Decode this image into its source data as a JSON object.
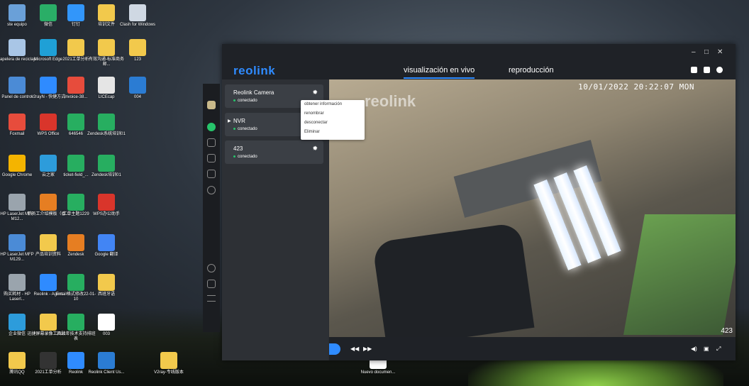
{
  "desktop": {
    "icons": [
      {
        "label": "ste equipo",
        "icon": "computer-icon",
        "color": "#6aa0d8"
      },
      {
        "label": "微信",
        "icon": "wechat-icon",
        "color": "#2aae67"
      },
      {
        "label": "钉钉",
        "icon": "dingtalk-icon",
        "color": "#3296fa"
      },
      {
        "label": "培训文件",
        "icon": "folder-icon",
        "color": "#f2c94c"
      },
      {
        "label": "Clash for Windows",
        "icon": "clash-icon",
        "color": "#cfd8e3"
      },
      {
        "label": "Papelera de reciclaje",
        "icon": "recycle-bin-icon",
        "color": "#a9c6e6"
      },
      {
        "label": "Microsoft Edge",
        "icon": "edge-icon",
        "color": "#1fa0d6"
      },
      {
        "label": "2021工单分析",
        "icon": "excel-icon",
        "color": "#f2c94c"
      },
      {
        "label": "有效沟通-标准商务邮...",
        "icon": "folder-icon",
        "color": "#f2c94c"
      },
      {
        "label": "123",
        "icon": "folder-icon",
        "color": "#f2c94c"
      },
      {
        "label": "Panel de control",
        "icon": "control-panel-icon",
        "color": "#4b8bd6"
      },
      {
        "label": "v2rayN - 快捷方式",
        "icon": "v2rayn-icon",
        "color": "#2f8bff"
      },
      {
        "label": "Invoice-38...",
        "icon": "pdf-icon",
        "color": "#e74c3c"
      },
      {
        "label": "LICEcap",
        "icon": "licecap-icon",
        "color": "#e5e5e5"
      },
      {
        "label": "004",
        "icon": "word-icon",
        "color": "#2b7cd3"
      },
      {
        "label": "Foxmail",
        "icon": "foxmail-icon",
        "color": "#e74c3c"
      },
      {
        "label": "WPS Office",
        "icon": "wps-icon",
        "color": "#d9352b"
      },
      {
        "label": "646546",
        "icon": "sheet-icon",
        "color": "#27ae60"
      },
      {
        "label": "Zendesk系统培训01",
        "icon": "sheet-icon",
        "color": "#27ae60"
      },
      {
        "label": "Google Chrome",
        "icon": "chrome-icon",
        "color": "#f4b400"
      },
      {
        "label": "云之家",
        "icon": "cloud-icon",
        "color": "#2d9cdb"
      },
      {
        "label": "ticket-field_...",
        "icon": "sheet-icon",
        "color": "#27ae60"
      },
      {
        "label": "Zendesk培训01",
        "icon": "sheet-icon",
        "color": "#27ae60"
      },
      {
        "label": "HP LaserJet MFP M12...",
        "icon": "printer-icon",
        "color": "#9aa4ad"
      },
      {
        "label": "新员工介绍模板（香...",
        "icon": "ppt-icon",
        "color": "#e67e22"
      },
      {
        "label": "工单主题1229",
        "icon": "sheet-icon",
        "color": "#27ae60"
      },
      {
        "label": "WPS办公助手",
        "icon": "wps-icon",
        "color": "#d9352b"
      },
      {
        "label": "HP LaserJet MFP M129...",
        "icon": "scanner-icon",
        "color": "#4b8bd6"
      },
      {
        "label": "产品培训资料",
        "icon": "folder-icon",
        "color": "#f2c94c"
      },
      {
        "label": "Zendesk",
        "icon": "ppt-icon",
        "color": "#e67e22"
      },
      {
        "label": "Google 翻译",
        "icon": "translate-icon",
        "color": "#4285f4"
      },
      {
        "label": "购买耗材 - HP Laserl...",
        "icon": "printer-icon",
        "color": "#9aa4ad"
      },
      {
        "label": "Reolink - Agent",
        "icon": "reolink-icon",
        "color": "#2f8bff"
      },
      {
        "label": "Email格式修改22-01-10",
        "icon": "sheet-icon",
        "color": "#27ae60"
      },
      {
        "label": "西班牙语",
        "icon": "folder-icon",
        "color": "#f2c94c"
      },
      {
        "label": "企业微信",
        "icon": "wework-icon",
        "color": "#2d9cdb"
      },
      {
        "label": "迅捷屏幕录像工具破...",
        "icon": "folder-icon",
        "color": "#f2c94c"
      },
      {
        "label": "2021年技术支持排班表",
        "icon": "sheet-icon",
        "color": "#27ae60"
      },
      {
        "label": "003",
        "icon": "doc-icon",
        "color": "#ffffff"
      },
      {
        "label": "腾讯QQ",
        "icon": "qq-icon",
        "color": "#f2c94c"
      },
      {
        "label": "2021工单分析",
        "icon": "7zip-icon",
        "color": "#333333"
      },
      {
        "label": "Reolink",
        "icon": "reolink-icon",
        "color": "#2f8bff"
      },
      {
        "label": "Reolink Client Us...",
        "icon": "word-icon",
        "color": "#2b7cd3"
      },
      {
        "label": "V2ray-专线版本",
        "icon": "folder-icon",
        "color": "#f2c94c"
      },
      {
        "label": "Nuevo documen...",
        "icon": "doc-icon",
        "color": "#ffffff"
      }
    ]
  },
  "app": {
    "logo": "reolink",
    "tabs": [
      {
        "label": "visualización en vivo",
        "active": true
      },
      {
        "label": "reproducción",
        "active": false
      }
    ],
    "window_controls": {
      "minimize": "–",
      "maximize": "□",
      "close": "✕"
    },
    "devices": [
      {
        "name": "Reolink Camera",
        "status": "conectado"
      },
      {
        "name": "NVR",
        "status": "conectado"
      },
      {
        "name": "423",
        "status": "conectado"
      }
    ],
    "context_menu": [
      "obtener información",
      "renombrar",
      "desconectar",
      "Eliminar"
    ],
    "video": {
      "timestamp": "10/01/2022 20:22:07 MON",
      "watermark": "reolink",
      "camera_label": "423"
    },
    "controls": {
      "prev": "◀◀",
      "next": "▶▶"
    }
  },
  "colors": {
    "accent": "#2f8bff",
    "online": "#27c46b"
  }
}
